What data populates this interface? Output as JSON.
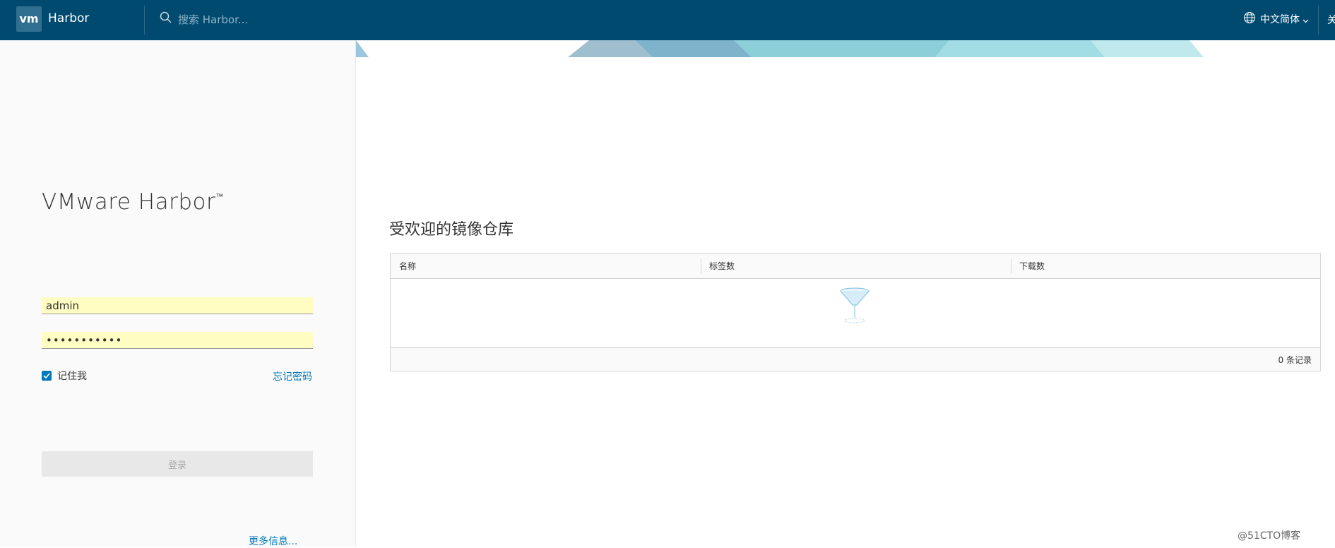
{
  "header": {
    "logo_text": "vm",
    "app_name": "Harbor",
    "search_placeholder": "搜索 Harbor...",
    "language": "中文简体",
    "about_partial": "关"
  },
  "login": {
    "title": "VMware Harbor",
    "trademark": "™",
    "username_value": "admin",
    "password_value": "•••••••••••",
    "remember_me_label": "记住我",
    "remember_me_checked": true,
    "forgot_password": "忘记密码",
    "login_button": "登录",
    "more_info": "更多信息..."
  },
  "main": {
    "section_title": "受欢迎的镜像仓库",
    "table": {
      "columns": [
        "名称",
        "标签数",
        "下载数"
      ],
      "rows": [],
      "footer_count": "0 条记录"
    }
  },
  "watermark": "@51CTO博客",
  "colors": {
    "header_bg": "#004a70",
    "accent": "#0079b8",
    "autofill_bg": "#fffdc2"
  },
  "icons": [
    "search-icon",
    "globe-icon",
    "chevron-down-icon",
    "check-icon",
    "empty-filter-icon"
  ]
}
